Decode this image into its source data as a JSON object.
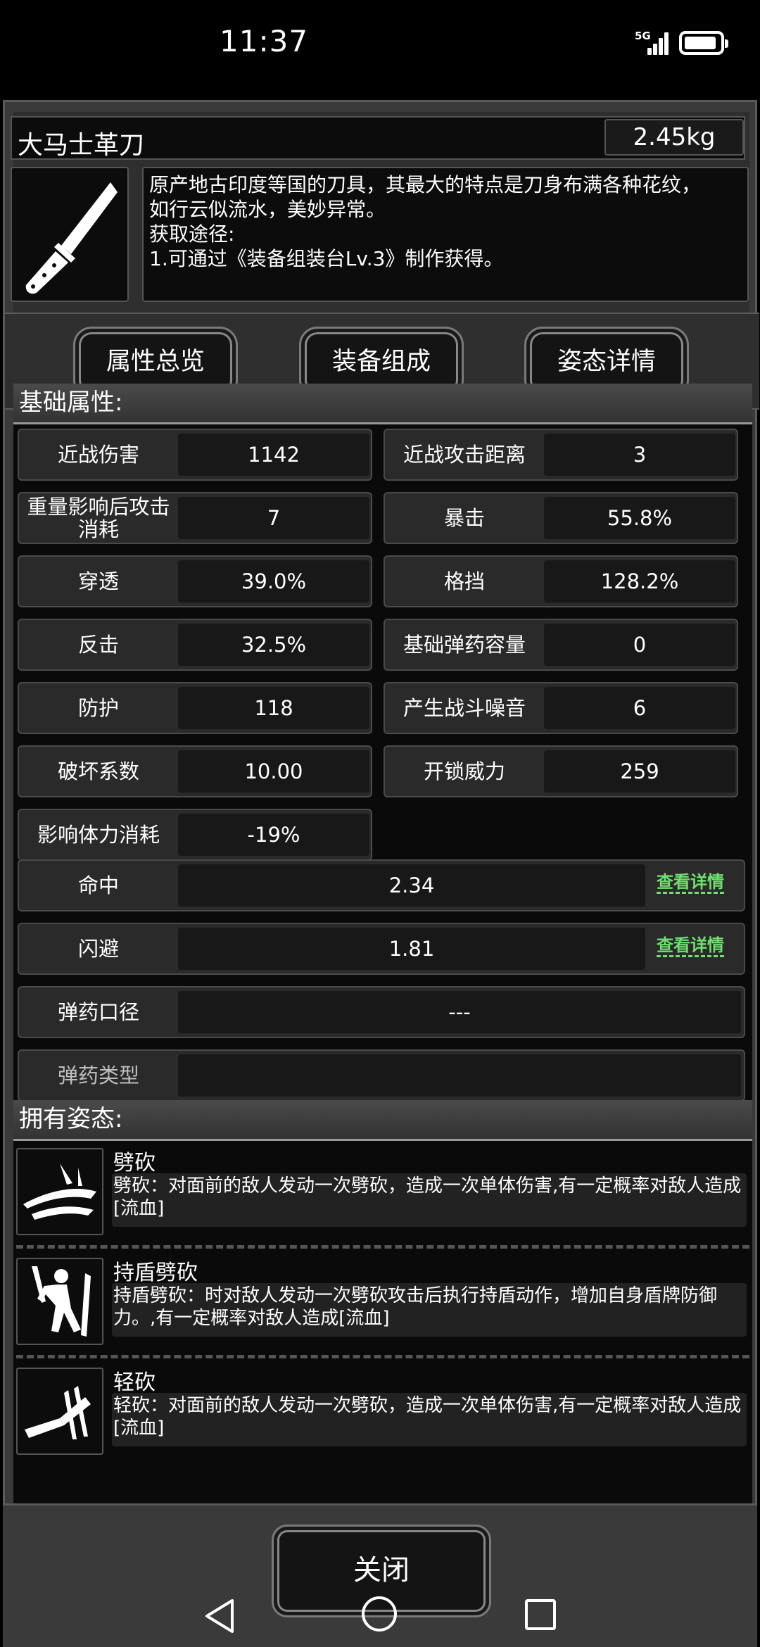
{
  "status_bar": {
    "time": "11:37",
    "network": "5G"
  },
  "item": {
    "name": "大马士革刀",
    "weight": "2.45kg",
    "icon": "knife-icon",
    "description_lines": [
      "原产地古印度等国的刀具，其最大的特点是刀身布满各种花纹，",
      "如行云似流水，美妙异常。",
      "获取途径:",
      "1.可通过《装备组装台Lv.3》制作获得。"
    ]
  },
  "tabs": [
    "属性总览",
    "装备组成",
    "姿态详情"
  ],
  "basic_section": {
    "title": "基础属性:",
    "stats": [
      {
        "label": "近战伤害",
        "value": "1142"
      },
      {
        "label": "近战攻击距离",
        "value": "3"
      },
      {
        "label": "重量影响后攻击消耗",
        "value": "7"
      },
      {
        "label": "暴击",
        "value": "55.8%"
      },
      {
        "label": "穿透",
        "value": "39.0%"
      },
      {
        "label": "格挡",
        "value": "128.2%"
      },
      {
        "label": "反击",
        "value": "32.5%"
      },
      {
        "label": "基础弹药容量",
        "value": "0"
      },
      {
        "label": "防护",
        "value": "118"
      },
      {
        "label": "产生战斗噪音",
        "value": "6"
      },
      {
        "label": "破坏系数",
        "value": "10.00"
      },
      {
        "label": "开锁威力",
        "value": "259"
      },
      {
        "label": "影响体力消耗",
        "value": "-19%"
      }
    ],
    "wide_stats": [
      {
        "label": "命中",
        "value": "2.34",
        "link": "查看详情"
      },
      {
        "label": "闪避",
        "value": "1.81",
        "link": "查看详情"
      },
      {
        "label": "弹药口径",
        "value": "---"
      },
      {
        "label": "弹药类型",
        "value": ""
      }
    ]
  },
  "stance_section": {
    "title": "拥有姿态:",
    "stances": [
      {
        "name": "劈砍",
        "icon": "slash-icon",
        "desc": "劈砍：对面前的敌人发动一次劈砍，造成一次单体伤害,有一定概率对敌人造成[流血]"
      },
      {
        "name": "持盾劈砍",
        "icon": "shield-slash-icon",
        "desc": "持盾劈砍：时对敌人发动一次劈砍攻击后执行持盾动作，增加自身盾牌防御力。,有一定概率对敌人造成[流血]"
      },
      {
        "name": "轻砍",
        "icon": "light-slash-icon",
        "desc": "轻砍：对面前的敌人发动一次劈砍，造成一次单体伤害,有一定概率对敌人造成[流血]"
      }
    ]
  },
  "close_label": "关闭"
}
